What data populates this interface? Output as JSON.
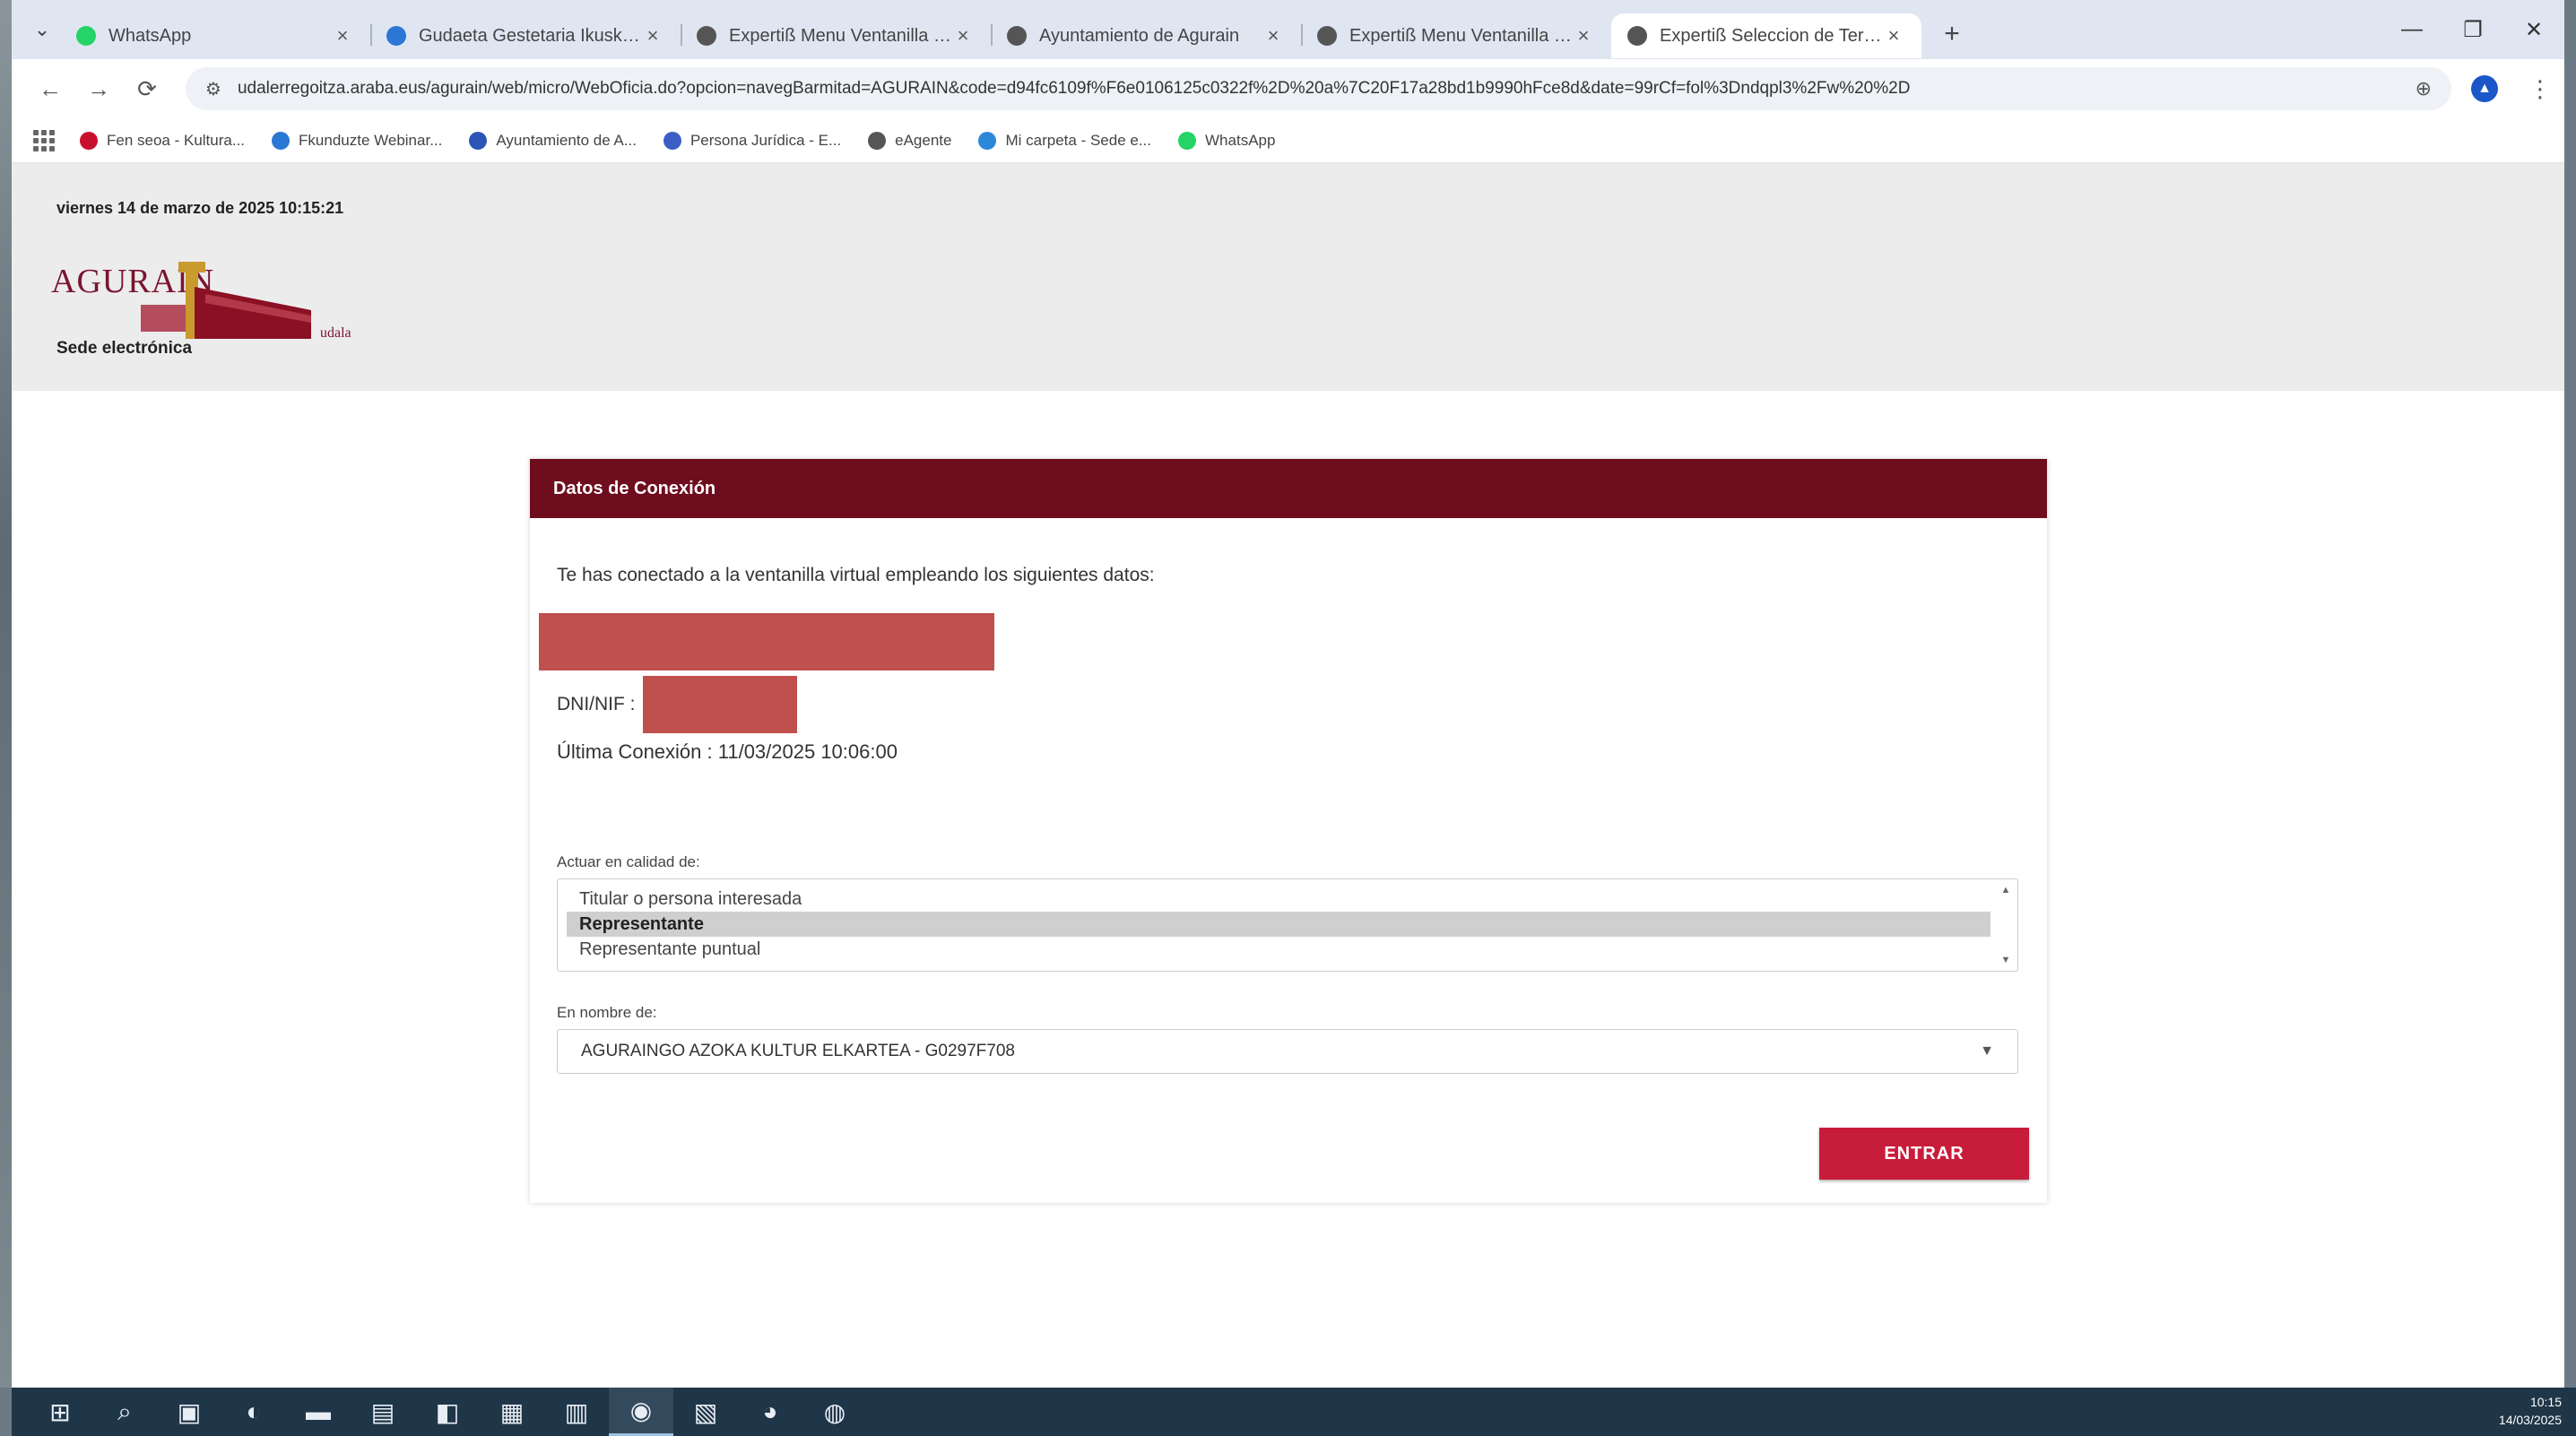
{
  "tabs": [
    {
      "title": "WhatsApp",
      "favicon_color": "#25d366",
      "active": false
    },
    {
      "title": "Gudaeta Gestetaria Ikuskaile - ...",
      "favicon_color": "#2b78d4",
      "active": false
    },
    {
      "title": "Expertiß Menu Ventanilla Virt...",
      "favicon_color": "#555555",
      "active": false
    },
    {
      "title": "Ayuntamiento de Agurain",
      "favicon_color": "#555555",
      "active": false
    },
    {
      "title": "Expertiß Menu Ventanilla Virt...",
      "favicon_color": "#555555",
      "active": false
    },
    {
      "title": "Expertiß Seleccion de Tercero",
      "favicon_color": "#555555",
      "active": true
    }
  ],
  "new_tab_symbol": "+",
  "window": {
    "minimize": "—",
    "restore": "❐",
    "close": "✕"
  },
  "address_bar": {
    "url": "udalerregoitza.araba.eus/agurain/web/micro/WebOficia.do?opcion=navegBarmitad=AGURAIN&code=d94fc6109f%F6e0106125c0322f%2D%20a%7C20F17a28bd1b9990hFce8d&date=99rCf=fol%3Dndqpl3%2Fw%20%2D",
    "tab_menu": "⌄",
    "back": "←",
    "forward": "→",
    "reload": "⟳",
    "site_info": "⚙",
    "extension_icon": "⊕",
    "profile_initial": "▲",
    "menu": "⋮"
  },
  "bookmarks": [
    {
      "label": "Fen seoa - Kultura...",
      "color": "#c8102e"
    },
    {
      "label": "Fkunduzte Webinar...",
      "color": "#2b78d4"
    },
    {
      "label": "Ayuntamiento de A...",
      "color": "#2b56b8"
    },
    {
      "label": "Persona Jurídica - E...",
      "color": "#3a5fc4"
    },
    {
      "label": "eAgente",
      "color": "#555555"
    },
    {
      "label": "Mi carpeta - Sede e...",
      "color": "#2b88d8"
    },
    {
      "label": "WhatsApp",
      "color": "#25d366"
    }
  ],
  "header": {
    "datetime": "viernes 14 de marzo de 2025 10:15:21",
    "logo_text": "AGURAIN",
    "logo_sub": "udala",
    "sede": "Sede electrónica"
  },
  "card": {
    "title": "Datos de Conexión",
    "intro": "Te has conectado a la ventanilla virtual empleando los siguientes datos:",
    "dni_label": "DNI/NIF :",
    "last_connection": "Última Conexión : 11/03/2025 10:06:00",
    "act_label": "Actuar en calidad de:",
    "act_options": [
      "Titular o persona interesada",
      "Representante",
      "Representante puntual"
    ],
    "act_selected": 1,
    "on_behalf_label": "En nombre de:",
    "on_behalf_value": "AGURAINGO AZOKA KULTUR ELKARTEA - G0297F708",
    "submit_label": "ENTRAR"
  },
  "taskbar": {
    "items": [
      {
        "name": "start",
        "glyph": "⊞"
      },
      {
        "name": "search",
        "glyph": "⌕"
      },
      {
        "name": "task-view",
        "glyph": "▣"
      },
      {
        "name": "edge",
        "glyph": "◐"
      },
      {
        "name": "file-explorer",
        "glyph": "▬"
      },
      {
        "name": "excel",
        "glyph": "▤"
      },
      {
        "name": "app-teal",
        "glyph": "◧"
      },
      {
        "name": "app-orange",
        "glyph": "▦"
      },
      {
        "name": "word",
        "glyph": "▥"
      },
      {
        "name": "chrome",
        "glyph": "◉"
      },
      {
        "name": "acrobat",
        "glyph": "▧"
      },
      {
        "name": "firefox",
        "glyph": "◕"
      },
      {
        "name": "powerpoint",
        "glyph": "◍"
      }
    ],
    "active_index": 9,
    "time": "10:15",
    "date": "14/03/2025"
  },
  "colors": {
    "brand": "#6e0d1e",
    "button": "#c81d3a",
    "redaction": "#c0504d"
  }
}
